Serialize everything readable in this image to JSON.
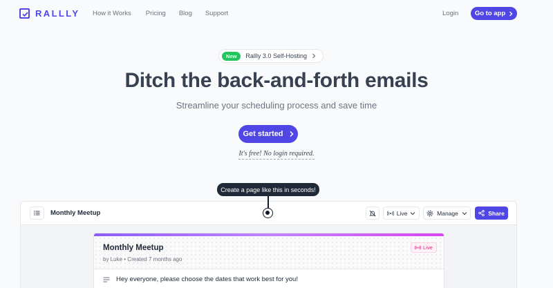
{
  "brand": {
    "name": "RALLLY",
    "color": "#4f46e5"
  },
  "nav": {
    "links": [
      "How it Works",
      "Pricing",
      "Blog",
      "Support"
    ],
    "login": "Login",
    "goto_app": "Go to app"
  },
  "hero": {
    "badge_new": "New",
    "badge_text": "Rallly 3.0 Self-Hosting",
    "title": "Ditch the back-and-forth emails",
    "subtitle": "Streamline your scheduling process and save time",
    "cta": "Get started",
    "note": "It's free! No login required."
  },
  "tooltip": "Create a page like this in seconds!",
  "app_preview": {
    "title": "Monthly Meetup",
    "live_button": "Live",
    "manage_button": "Manage",
    "share_button": "Share",
    "poll": {
      "title": "Monthly Meetup",
      "author": "by Luke",
      "created": "Created 7 months ago",
      "status": "Live",
      "description": "Hey everyone, please choose the dates that work best for you!"
    }
  },
  "icons": [
    "check-logo-icon",
    "chevron-right-icon",
    "list-icon",
    "bell-off-icon",
    "broadcast-icon",
    "chevron-down-icon",
    "gear-icon",
    "share-icon",
    "text-lines-icon"
  ],
  "colors": {
    "accent": "#4f46e5",
    "new_badge": "#22c55e",
    "live_tag": "#db2777"
  }
}
